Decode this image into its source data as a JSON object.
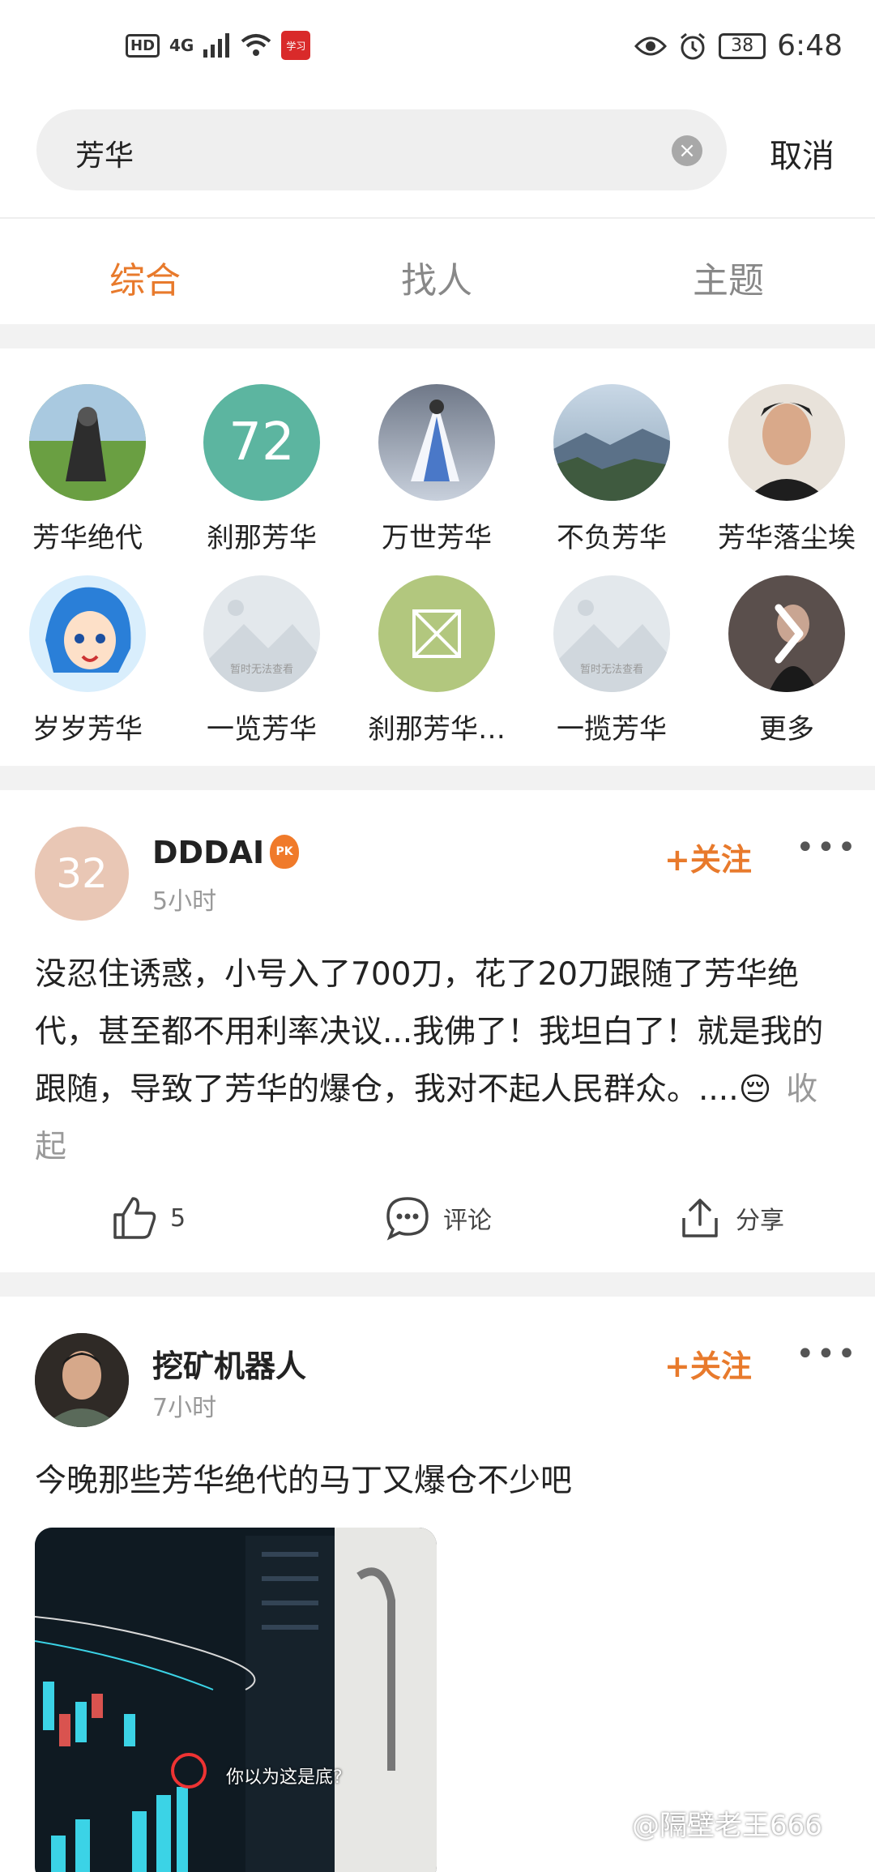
{
  "status_bar": {
    "hd": "HD",
    "network": "4G",
    "battery": "38",
    "time": "6:48",
    "app_badge": "学习"
  },
  "search": {
    "query": "芳华",
    "cancel": "取消"
  },
  "tabs": [
    {
      "label": "综合",
      "active": true
    },
    {
      "label": "找人",
      "active": false
    },
    {
      "label": "主题",
      "active": false
    }
  ],
  "users": [
    {
      "name": "芳华绝代",
      "avatar": "photo-person-on-grass"
    },
    {
      "name": "刹那芳华",
      "avatar_text": "72",
      "avatar_color": "#5cb5a0"
    },
    {
      "name": "万世芳华",
      "avatar": "illustration-white-robe"
    },
    {
      "name": "不负芳华",
      "avatar": "photo-mountains"
    },
    {
      "name": "芳华落尘埃",
      "avatar": "photo-man-portrait"
    },
    {
      "name": "岁岁芳华",
      "avatar": "anime-blue-hair"
    },
    {
      "name": "一览芳华",
      "avatar_placeholder": "暂时无法查看"
    },
    {
      "name": "刹那芳华…",
      "avatar": "image-placeholder-icon",
      "avatar_color": "#b2c77e"
    },
    {
      "name": "一揽芳华",
      "avatar_placeholder": "暂时无法查看"
    },
    {
      "name": "更多",
      "avatar": "chevron-right-icon"
    }
  ],
  "posts": [
    {
      "author": "DDDAI",
      "avatar_text": "32",
      "avatar_color": "#e9c7b5",
      "badge": "PK",
      "time": "5小时",
      "follow": "+关注",
      "more": "•••",
      "body": "没忍住诱惑，小号入了700刀，花了20刀跟随了芳华绝代，甚至都不用利率决议...我佛了！我坦白了！就是我的跟随，导致了芳华的爆仓，我对不起人民群众。....😔",
      "collapse": "收起",
      "likes": "5",
      "comment_label": "评论",
      "share_label": "分享"
    },
    {
      "author": "挖矿机器人",
      "time": "7小时",
      "follow": "+关注",
      "more": "•••",
      "body": "今晚那些芳华绝代的马丁又爆仓不少吧",
      "image_caption": "你以为这是底?"
    }
  ],
  "watermark": "@隔壁老王666"
}
